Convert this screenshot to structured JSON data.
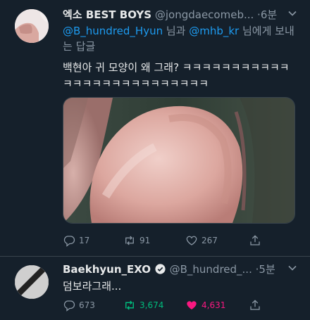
{
  "tweet1": {
    "name": "엑소 BEST BOYS",
    "handle": "@jongdaecomeb...",
    "sep": "·",
    "time": "6분",
    "reply_mention1": "@B_hundred_Hyun",
    "reply_conj": " 님과 ",
    "reply_mention2": "@mhb_kr",
    "reply_suffix": " 님에게 보내는 답글",
    "text": "백현아 귀 모양이 왜 그래? ㅋㅋㅋㅋㅋㅋㅋㅋㅋㅋㅋㅋㅋㅋㅋㅋㅋㅋㅋㅋㅋㅋㅋㅋㅋㅋ",
    "reply_count": "17",
    "retweet_count": "91",
    "like_count": "267"
  },
  "tweet2": {
    "name": "Baekhyun_EXO",
    "handle": "@B_hundred_...",
    "sep": "·",
    "time": "5분",
    "text": "덤보라그래...",
    "reply_count": "673",
    "retweet_count": "3,674",
    "like_count": "4,631"
  },
  "colors": {
    "background": "#15202b",
    "accent": "#1d9bf0",
    "muted": "#8b98a5",
    "retweet_active": "#00ba7c",
    "like_active": "#f91880"
  }
}
